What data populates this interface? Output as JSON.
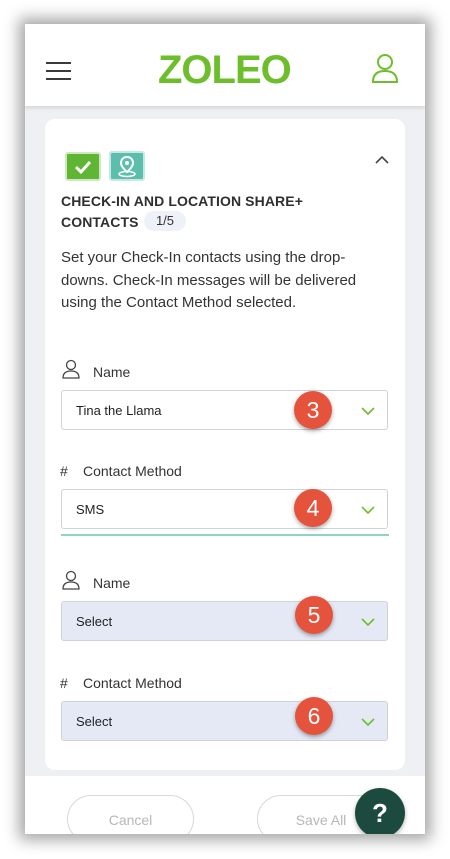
{
  "header": {
    "menu_icon": "hamburger-menu-icon",
    "logo_text": "ZOLEO",
    "account_icon": "user-profile-icon",
    "brand_color": "#6cbf2a"
  },
  "section": {
    "check_icon": "checkmark-icon",
    "location_icon": "location-pin-icon",
    "collapse_icon": "chevron-up-icon",
    "title_line1": "CHECK-IN AND LOCATION SHARE+",
    "title_line2": "CONTACTS",
    "step": "1/5",
    "description": "Set your Check-In contacts using the drop-downs. Check-In messages will be delivered using the Contact Method selected."
  },
  "contacts": [
    {
      "name_label": "Name",
      "name_value": "Tina the Llama",
      "name_marker": "3",
      "method_label": "Contact Method",
      "method_value": "SMS",
      "method_marker": "4"
    },
    {
      "name_label": "Name",
      "name_value": "Select",
      "name_marker": "5",
      "method_label": "Contact Method",
      "method_value": "Select",
      "method_marker": "6"
    }
  ],
  "hash_symbol": "#",
  "footer": {
    "cancel_label": "Cancel",
    "save_label": "Save All",
    "help_label": "?"
  }
}
